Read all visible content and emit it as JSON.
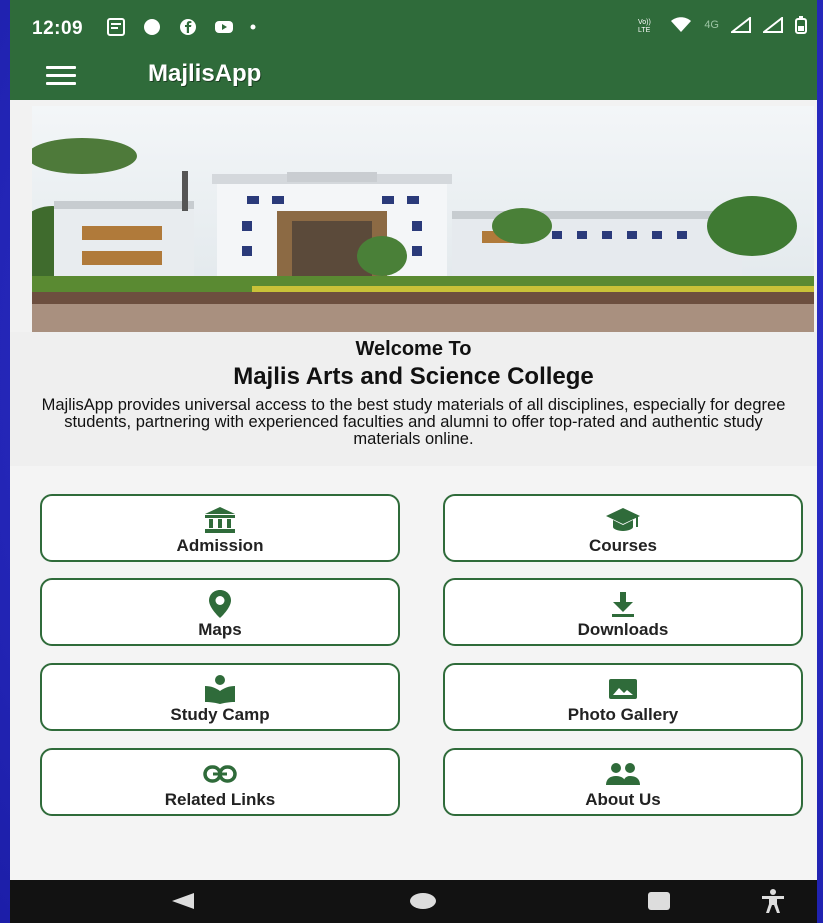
{
  "status": {
    "time": "12:09",
    "network": "4G"
  },
  "appbar": {
    "title": "MajlisApp"
  },
  "welcome": {
    "line1": "Welcome To",
    "college": "Majlis Arts and Science College",
    "description": "MajlisApp provides universal access to the best study materials of all disciplines, especially for degree students, partnering with experienced faculties and alumni to offer top-rated and authentic study materials online."
  },
  "menu": {
    "admission": "Admission",
    "courses": "Courses",
    "maps": "Maps",
    "downloads": "Downloads",
    "study_camp": "Study Camp",
    "photo_gallery": "Photo Gallery",
    "related_links": "Related Links",
    "about_us": "About Us"
  },
  "colors": {
    "primary": "#2f6b3a",
    "background": "#f2f2f2",
    "navbar": "#121212"
  },
  "icons": {
    "admission": "bank-icon",
    "courses": "graduation-cap-icon",
    "maps": "map-pin-icon",
    "downloads": "download-icon",
    "study_camp": "book-reader-icon",
    "photo_gallery": "image-icon",
    "related_links": "link-icon",
    "about_us": "users-icon"
  }
}
